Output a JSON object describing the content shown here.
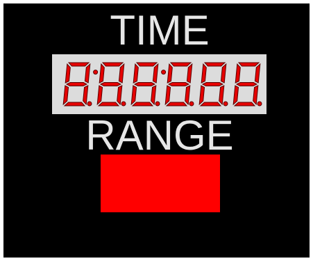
{
  "labels": {
    "time": "TIME",
    "range": "RANGE"
  },
  "display": {
    "digit_count": 6,
    "segments_lit": [
      [
        "a",
        "b",
        "c",
        "d",
        "e",
        "f",
        "g",
        "dp"
      ],
      [
        "a",
        "b",
        "c",
        "d",
        "e",
        "f",
        "g",
        "dp"
      ],
      [
        "a",
        "b",
        "c",
        "d",
        "e",
        "f",
        "g",
        "dp"
      ],
      [
        "a",
        "b",
        "c",
        "d",
        "e",
        "f",
        "g",
        "dp"
      ],
      [
        "a",
        "b",
        "c",
        "d",
        "e",
        "f",
        "g",
        "dp"
      ],
      [
        "a",
        "b",
        "c",
        "d",
        "e",
        "f",
        "g",
        "dp"
      ]
    ],
    "colon_after": [
      1,
      3
    ],
    "segment_color": "#e60000",
    "segment_outline_color": "#5a0000",
    "display_background": "#dcdcdc"
  },
  "range_indicator": {
    "color": "#ff0000"
  },
  "colors": {
    "panel_background": "#000000",
    "label_color": "#e6e6e6",
    "border": "#ffffff"
  }
}
